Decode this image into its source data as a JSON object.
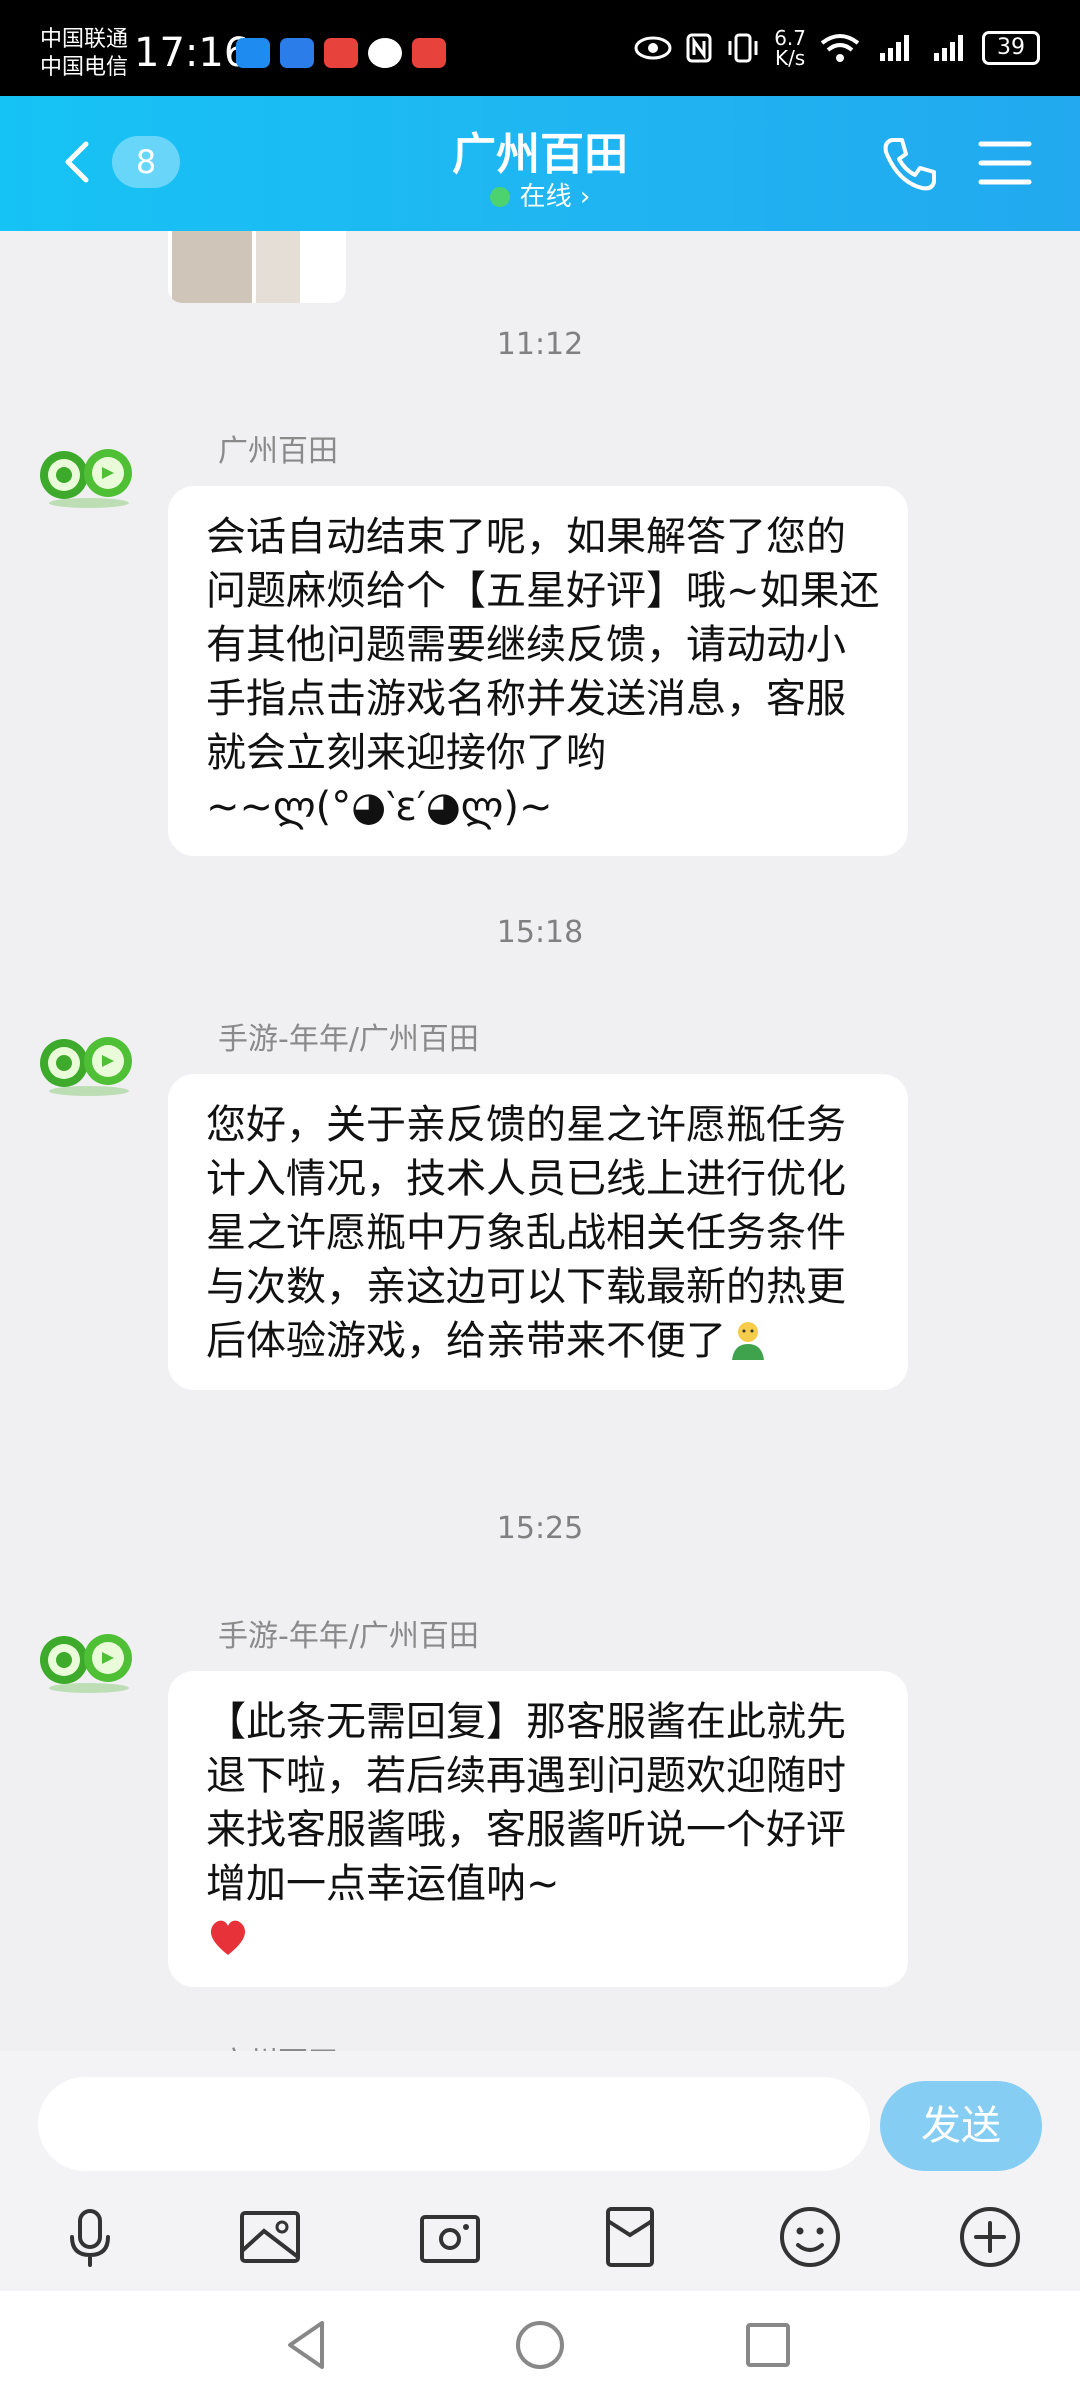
{
  "status_bar": {
    "carrier1": "中国联通",
    "carrier2": "中国电信",
    "time": "17:16",
    "net_speed_value": "6.7",
    "net_speed_unit": "K/s",
    "battery": "39"
  },
  "header": {
    "unread_count": "8",
    "title": "广州百田",
    "status": "在线 ›"
  },
  "messages": [
    {
      "time": "11:12",
      "sender": "广州百田",
      "text": "会话自动结束了呢，如果解答了您的问题麻烦给个【五星好评】哦~如果还有其他问题需要继续反馈，请动动小手指点击游戏名称并发送消息，客服就会立刻来迎接你了哟~~ლ(°◕‵ε′◕ლ)~"
    },
    {
      "time": "15:18",
      "sender": "手游-年年/广州百田",
      "text": "您好，关于亲反馈的星之许愿瓶任务计入情况，技术人员已线上进行优化星之许愿瓶中万象乱战相关任务条件与次数，亲这边可以下载最新的热更后体验游戏，给亲带来不便了"
    },
    {
      "time": "15:25",
      "sender": "手游-年年/广州百田",
      "text": "【此条无需回复】那客服酱在此就先退下啦，若后续再遇到问题欢迎随时来找客服酱哦，客服酱听说一个好评增加一点幸运值呐~"
    }
  ],
  "partial_sender": "广州百田",
  "input": {
    "value": "",
    "send_label": "发送"
  },
  "colors": {
    "header_gradient_start": "#16c3f5",
    "header_gradient_end": "#22a9ef",
    "send_button": "#86cdf4",
    "online_dot": "#4cd26f"
  },
  "icons": [
    "back-icon",
    "phone-icon",
    "menu-icon",
    "microphone-icon",
    "image-icon",
    "camera-icon",
    "red-packet-icon",
    "emoji-icon",
    "plus-icon"
  ]
}
